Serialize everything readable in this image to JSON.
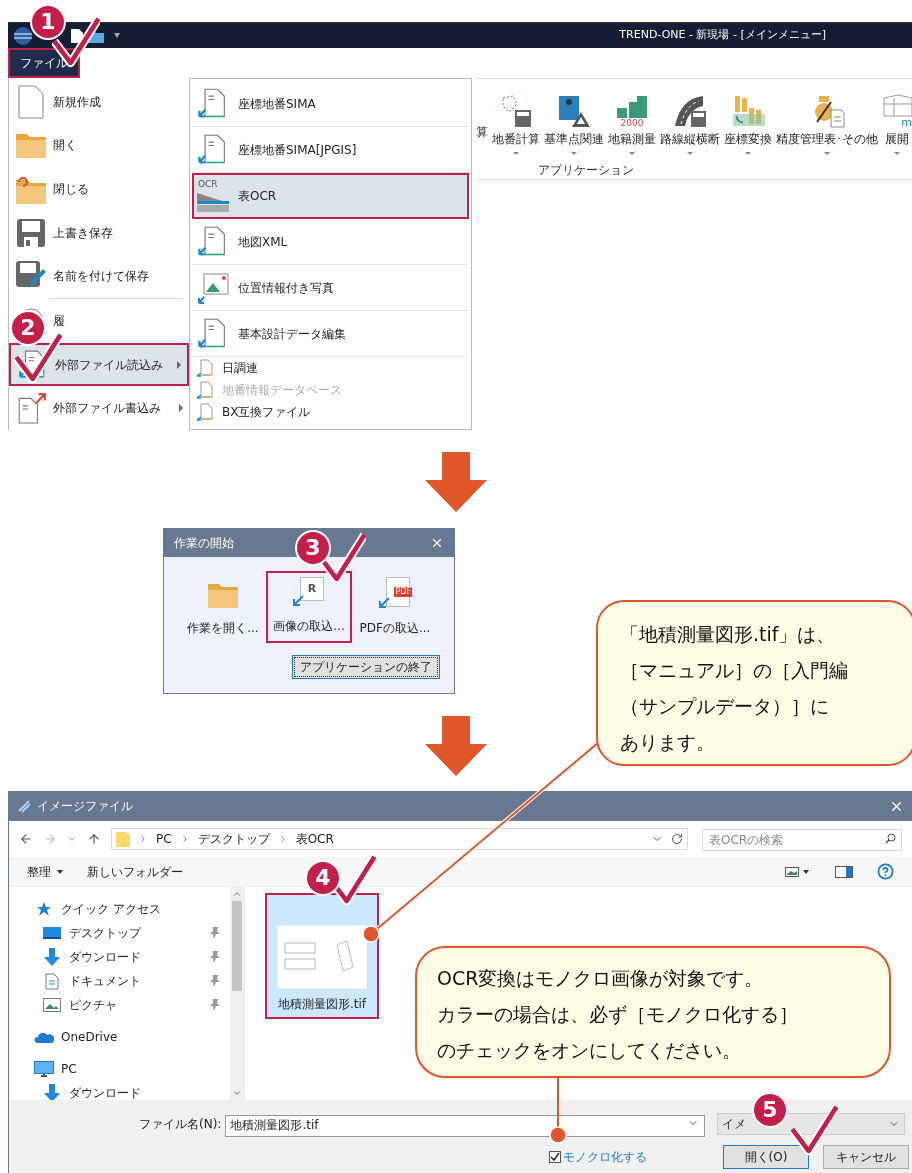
{
  "app": {
    "title": "TREND-ONE - 新現場 - [メインメニュー]",
    "file_tab": {
      "label": "ファイル",
      "selected": true
    },
    "file_menu": [
      {
        "kind": "new",
        "label": "新規作成",
        "has_submenu": false,
        "selected": false
      },
      {
        "kind": "open",
        "label": "開く",
        "has_submenu": false,
        "selected": false
      },
      {
        "kind": "close",
        "label": "閉じる",
        "has_submenu": false,
        "selected": false
      },
      {
        "kind": "save",
        "label": "上書き保存",
        "has_submenu": false,
        "selected": false
      },
      {
        "kind": "saveas",
        "label": "名前を付けて保存",
        "has_submenu": false,
        "selected": false
      },
      {
        "kind": "history",
        "label": "履",
        "has_submenu": false,
        "selected": false
      },
      {
        "kind": "import",
        "label": "外部ファイル読込み",
        "has_submenu": true,
        "selected": true
      },
      {
        "kind": "export",
        "label": "外部ファイル書込み",
        "has_submenu": true,
        "selected": false
      }
    ],
    "submenu": [
      {
        "kind": "large",
        "label": "座標地番SIMA",
        "selected": false,
        "disabled": false
      },
      {
        "kind": "large",
        "label": "座標地番SIMA[JPGIS]",
        "selected": false,
        "disabled": false
      },
      {
        "kind": "ocr",
        "icon_text": "OCR",
        "label": "表OCR",
        "selected": true,
        "disabled": false
      },
      {
        "kind": "large",
        "label": "地図XML",
        "selected": false,
        "disabled": false
      },
      {
        "kind": "photo",
        "label": "位置情報付き写真",
        "selected": false,
        "disabled": false
      },
      {
        "kind": "large",
        "label": "基本設計データ編集",
        "selected": false,
        "disabled": false
      },
      {
        "kind": "small",
        "label": "日調連",
        "selected": false,
        "disabled": false
      },
      {
        "kind": "small",
        "label": "地番情報データベース",
        "selected": false,
        "disabled": true
      },
      {
        "kind": "small",
        "label": "BX互換ファイル",
        "selected": false,
        "disabled": false
      }
    ],
    "ribbon": {
      "cut_label": "算",
      "buttons": [
        {
          "kind": "lot",
          "label": "地番計算"
        },
        {
          "kind": "survey",
          "label": "基準点関連"
        },
        {
          "kind": "cadastral",
          "label": "地籍測量",
          "icon_text": "2000"
        },
        {
          "kind": "road",
          "label": "路線縦横断"
        },
        {
          "kind": "convert",
          "label": "座標変換"
        },
        {
          "kind": "precision",
          "label": "精度管理表･その他"
        },
        {
          "kind": "develop",
          "label": "展開",
          "icon_text": "m"
        }
      ],
      "group": "アプリケーション"
    }
  },
  "start_dialog": {
    "title": "作業の開始",
    "options": [
      {
        "kind": "folder",
        "label": "作業を開く...",
        "selected": false
      },
      {
        "kind": "image",
        "icon_text": "R",
        "label": "画像の取込...",
        "selected": true
      },
      {
        "kind": "pdf",
        "icon_text": "PDF",
        "label": "PDFの取込...",
        "selected": false
      }
    ],
    "exit_button": "アプリケーションの終了"
  },
  "file_dialog": {
    "title": "イメージファイル",
    "path": [
      "PC",
      "デスクトップ",
      "表OCR"
    ],
    "search": {
      "placeholder": "表OCRの検索"
    },
    "organize": "整理",
    "new_folder": "新しいフォルダー",
    "nav": [
      {
        "kind": "star",
        "label": "クイック アクセス",
        "pinned": false,
        "children": [
          {
            "kind": "desktop",
            "label": "デスクトップ",
            "pinned": true
          },
          {
            "kind": "download",
            "label": "ダウンロード",
            "pinned": true
          },
          {
            "kind": "document",
            "label": "ドキュメント",
            "pinned": true
          },
          {
            "kind": "picture",
            "label": "ピクチャ",
            "pinned": true
          }
        ]
      },
      {
        "kind": "cloud",
        "label": "OneDrive",
        "pinned": false
      },
      {
        "kind": "pc",
        "label": "PC",
        "pinned": false,
        "children": [
          {
            "kind": "download",
            "label": "ダウンロード",
            "pinned": false
          }
        ]
      }
    ],
    "files": [
      {
        "name": "地積測量図形.tif",
        "selected": true
      }
    ],
    "filename_label": "ファイル名(N):",
    "filename_value": "地積測量図形.tif",
    "type_value": "イメ",
    "mono": {
      "label": "モノクロ化する",
      "checked": true
    },
    "open_button": "開く(O)",
    "cancel_button": "キャンセル"
  },
  "callouts": [
    {
      "lines": [
        "「地積測量図形.tif」は、",
        "［マニュアル］の［入門編",
        "（サンプルデータ）］に",
        "あります。"
      ]
    },
    {
      "lines": [
        "OCR変換はモノクロ画像が対象です。",
        "カラーの場合は、必ず［モノクロ化する］",
        "のチェックをオンにしてください。"
      ]
    }
  ],
  "steps": [
    "1",
    "2",
    "3",
    "4",
    "5"
  ]
}
